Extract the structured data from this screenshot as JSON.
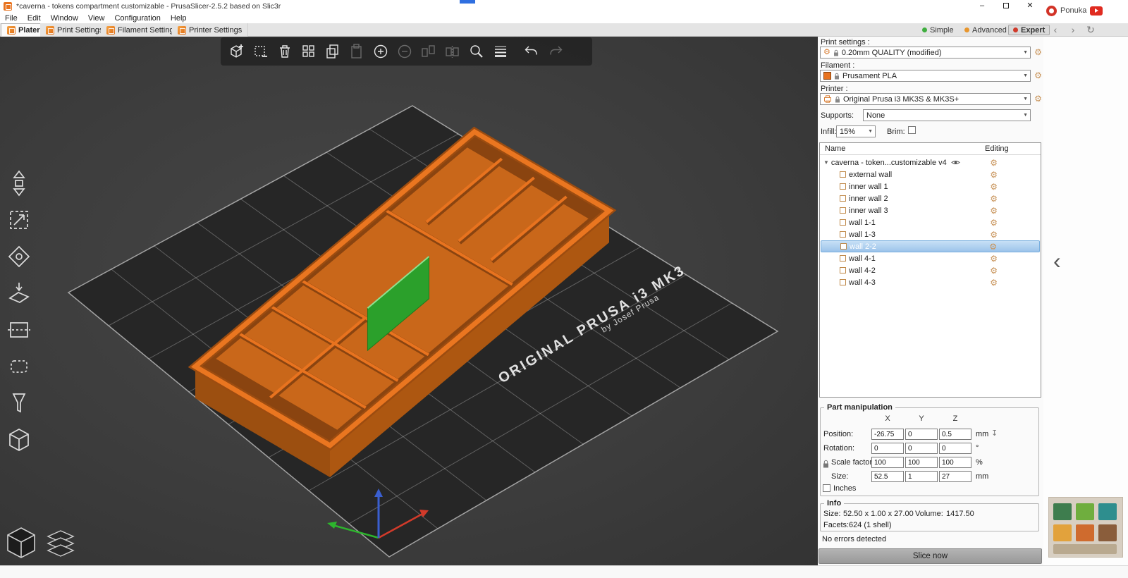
{
  "icons": {
    "gear": "⚙",
    "dropdown": "▼",
    "caret_down": "▼",
    "minimize": "–",
    "close": "✕",
    "back": "‹",
    "forward": "›",
    "refresh": "↻",
    "drop_to_bed": "↧"
  },
  "colors": {
    "accent_orange": "#e8731f",
    "model_orange": "#e8731f",
    "selected_part_green": "#2ba02b",
    "selection_blue": "#9cc3ea",
    "mode_simple": "#3fae3f",
    "mode_advanced": "#e8962d",
    "mode_expert": "#d03a2a"
  },
  "titlebar": {
    "app_title": "*caverna - tokens compartment customizable - PrusaSlicer-2.5.2 based on Slic3r"
  },
  "menubar": {
    "items": [
      "File",
      "Edit",
      "Window",
      "View",
      "Configuration",
      "Help"
    ]
  },
  "tabbar": {
    "tabs": [
      {
        "label": "Plater"
      },
      {
        "label": "Print Settings"
      },
      {
        "label": "Filament Settings"
      },
      {
        "label": "Printer Settings"
      }
    ],
    "modes": [
      {
        "label": "Simple"
      },
      {
        "label": "Advanced"
      },
      {
        "label": "Expert"
      }
    ]
  },
  "notification": {
    "label": "Ponuka"
  },
  "viewport": {
    "bed_label": "ORIGINAL PRUSA i3 MK3",
    "bed_sublabel": "by Josef Prusa"
  },
  "panel": {
    "print_settings_label": "Print settings :",
    "print_settings_value": "0.20mm QUALITY (modified)",
    "filament_label": "Filament :",
    "filament_value": "Prusament PLA",
    "printer_label": "Printer :",
    "printer_value": "Original Prusa i3 MK3S & MK3S+",
    "supports_label": "Supports:",
    "supports_value": "None",
    "infill_label": "Infill:",
    "infill_value": "15%",
    "brim_label": "Brim:",
    "object_list": {
      "columns": [
        "Name",
        "Editing"
      ],
      "items": [
        {
          "label": "caverna - token...customizable v4",
          "level": 0
        },
        {
          "label": "external wall",
          "level": 1
        },
        {
          "label": "inner wall 1",
          "level": 1
        },
        {
          "label": "inner wall 2",
          "level": 1
        },
        {
          "label": "inner wall 3",
          "level": 1
        },
        {
          "label": "wall 1-1",
          "level": 1
        },
        {
          "label": "wall 1-3",
          "level": 1
        },
        {
          "label": "wall 2-2",
          "level": 1,
          "selected": true
        },
        {
          "label": "wall 4-1",
          "level": 1
        },
        {
          "label": "wall 4-2",
          "level": 1
        },
        {
          "label": "wall 4-3",
          "level": 1
        }
      ]
    },
    "part_manipulation": {
      "title": "Part manipulation",
      "axes": [
        "X",
        "Y",
        "Z"
      ],
      "rows": [
        {
          "label": "Position:",
          "values": [
            "-26.75",
            "0",
            "0.5"
          ],
          "unit": "mm"
        },
        {
          "label": "Rotation:",
          "values": [
            "0",
            "0",
            "0"
          ],
          "unit": "°"
        },
        {
          "label": "Scale factors:",
          "values": [
            "100",
            "100",
            "100"
          ],
          "unit": "%"
        },
        {
          "label": "Size:",
          "values": [
            "52.5",
            "1",
            "27"
          ],
          "unit": "mm"
        }
      ],
      "inches_label": "Inches"
    },
    "info": {
      "title": "Info",
      "size_label": "Size:",
      "size_value": "52.50 x 1.00 x 27.00",
      "volume_label": "Volume:",
      "volume_value": "1417.50",
      "facets_label": "Facets:",
      "facets_value": "624 (1 shell)",
      "errors": "No errors detected"
    },
    "slice_button": "Slice now"
  }
}
